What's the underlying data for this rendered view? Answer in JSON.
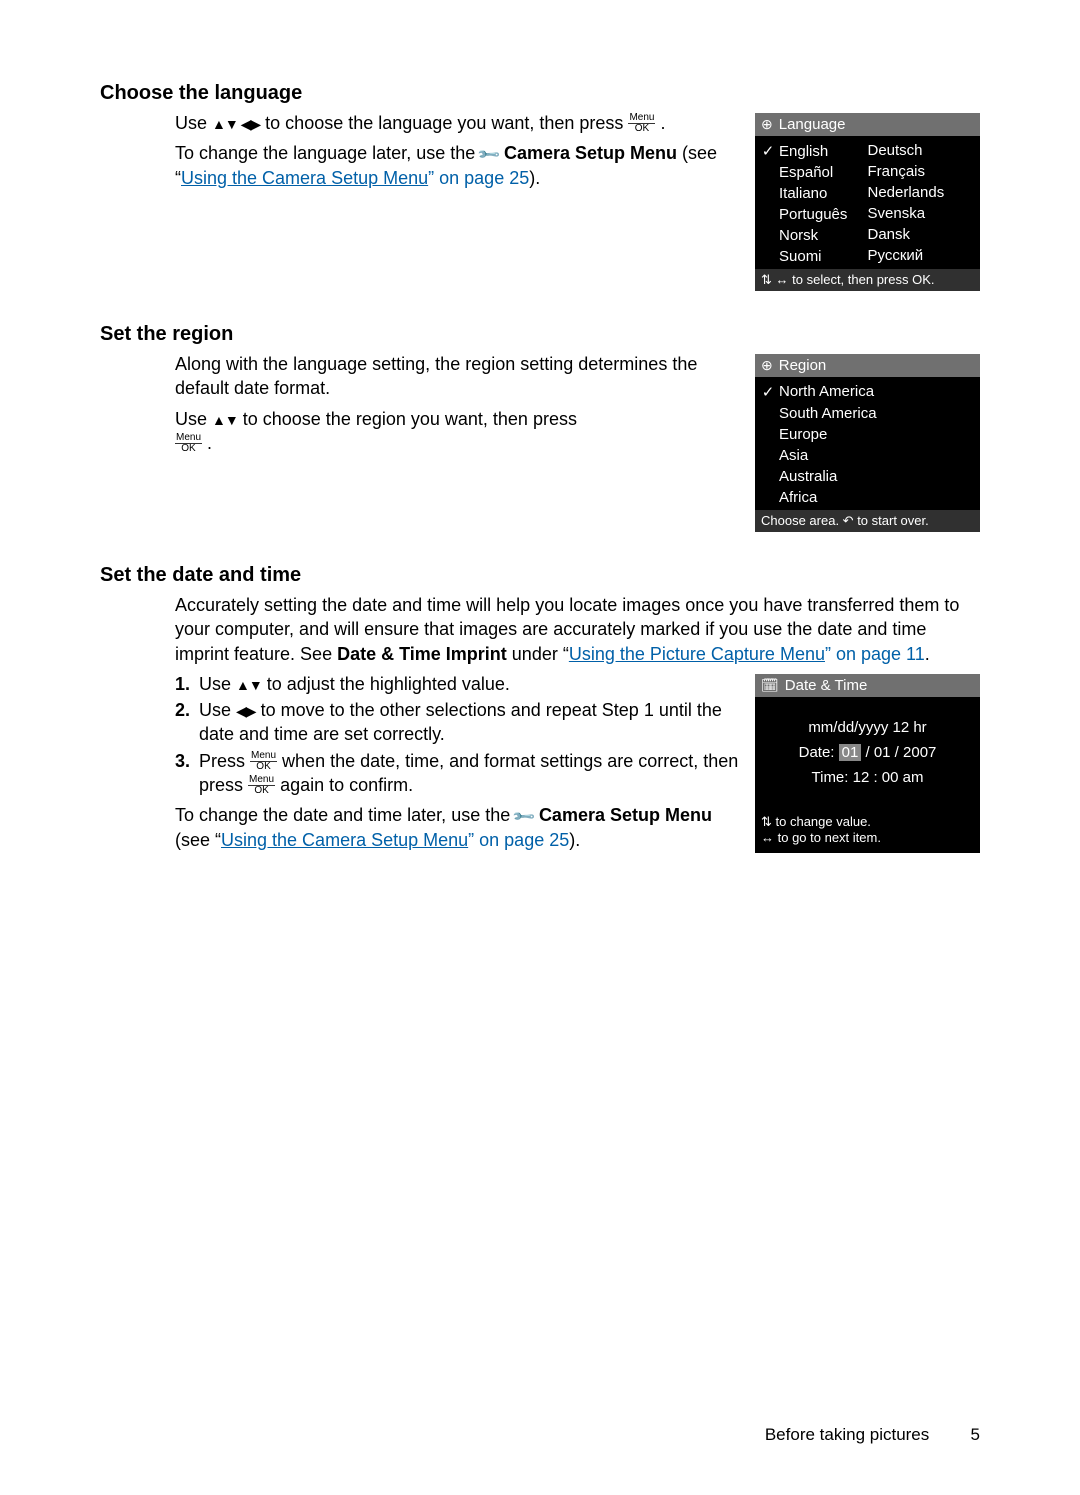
{
  "sections": {
    "language": {
      "heading": "Choose the language",
      "p1_pre": "Use ",
      "p1_mid": " to choose the language you want, then press ",
      "p1_post": ".",
      "p2_pre": "To change the language later, use the ",
      "p2_bold": "Camera Setup Menu",
      "p2_see": " (see “",
      "p2_link": "Using the Camera Setup Menu",
      "p2_after": "” on page 25",
      "p2_end": ")."
    },
    "region": {
      "heading": "Set the region",
      "p1": "Along with the language setting, the region setting determines the default date format.",
      "p2_pre": "Use ",
      "p2_mid": " to choose the region you want, then press ",
      "p2_post": "."
    },
    "datetime": {
      "heading": "Set the date and time",
      "intro_pre": "Accurately setting the date and time will help you locate images once you have transferred them to your computer, and will ensure that images are accurately marked if you use the date and time imprint feature. See ",
      "intro_bold": "Date & Time Imprint",
      "intro_under": " under “",
      "intro_link": "Using the Picture Capture Menu",
      "intro_after": "” on page 11",
      "intro_end": ".",
      "step1_pre": "Use ",
      "step1_post": " to adjust the highlighted value.",
      "step2_pre": "Use ",
      "step2_post": " to move to the other selections and repeat Step 1 until the date and time are set correctly.",
      "step3_pre": "Press ",
      "step3_mid": " when the date, time, and format settings are correct, then press ",
      "step3_post": " again to confirm.",
      "tail_pre": "To change the date and time later, use the ",
      "tail_bold": "Camera Setup Menu",
      "tail_see": " (see “",
      "tail_link": "Using the Camera Setup Menu",
      "tail_after": "” on page 25",
      "tail_end": ")."
    }
  },
  "lcd_language": {
    "title": "Language",
    "left": [
      "English",
      "Español",
      "Italiano",
      "Português",
      "Norsk",
      "Suomi"
    ],
    "right": [
      "Deutsch",
      "Français",
      "Nederlands",
      "Svenska",
      "Dansk",
      "Русский"
    ],
    "selected_index": 0,
    "footer": " to select, then press OK."
  },
  "lcd_region": {
    "title": "Region",
    "items": [
      "North America",
      "South America",
      "Europe",
      "Asia",
      "Australia",
      "Africa"
    ],
    "selected_index": 0,
    "footer_pre": "Choose area. ",
    "footer_post": " to start over."
  },
  "lcd_datetime": {
    "title": "Date & Time",
    "format": "mm/dd/yyyy  12 hr",
    "date_label": "Date:",
    "date_hl": "01",
    "date_rest": " / 01 / 2007",
    "time_label": "Time:",
    "time_value": "  12 : 00  am",
    "footer1": " to change value.",
    "footer2": " to go to next item."
  },
  "menu_ok": {
    "top": "Menu",
    "bot": "OK"
  },
  "footer": {
    "text": "Before taking pictures",
    "page": "5"
  }
}
